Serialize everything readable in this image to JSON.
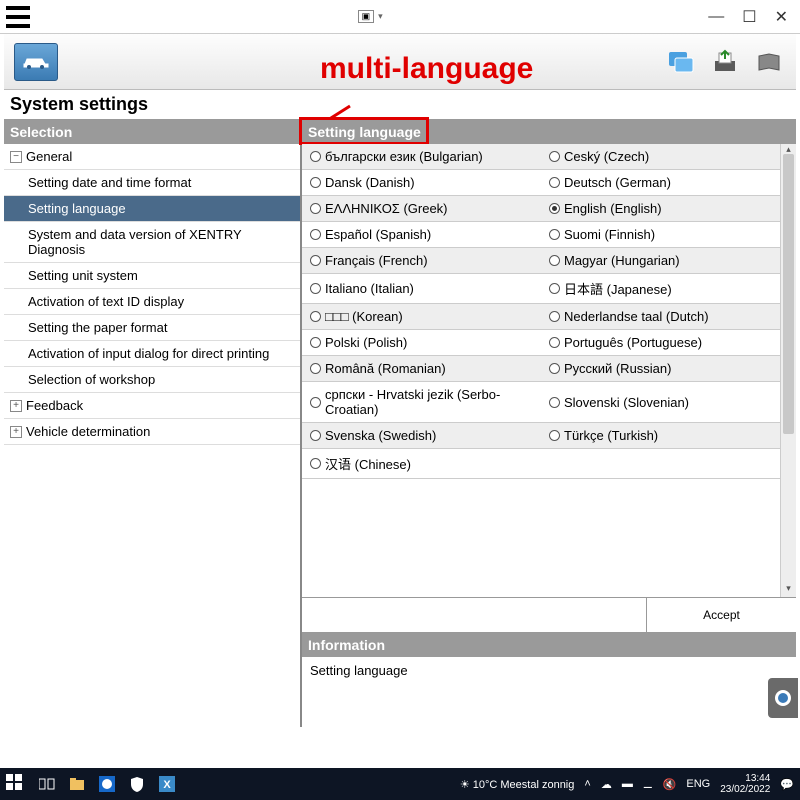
{
  "annotation": "multi-language",
  "window": {
    "min": "—",
    "max": "☐",
    "close": "✕"
  },
  "page_title": "System settings",
  "sidebar": {
    "header": "Selection",
    "groups": [
      {
        "label": "General",
        "expanded": true
      },
      {
        "label": "Feedback",
        "expanded": false
      },
      {
        "label": "Vehicle determination",
        "expanded": false
      }
    ],
    "general_items": [
      "Setting date and time format",
      "Setting language",
      "System and data version of XENTRY Diagnosis",
      "Setting unit system",
      "Activation of text ID display",
      "Setting the paper format",
      "Activation of input dialog for direct printing",
      "Selection of workshop"
    ],
    "active_index": 1
  },
  "main": {
    "header": "Setting language",
    "languages": [
      {
        "left": "български език (Bulgarian)",
        "right": "Ceský (Czech)"
      },
      {
        "left": "Dansk (Danish)",
        "right": "Deutsch (German)"
      },
      {
        "left": "ΕΛΛΗΝΙΚΟΣ (Greek)",
        "right": "English (English)",
        "right_checked": true
      },
      {
        "left": "Español (Spanish)",
        "right": "Suomi (Finnish)"
      },
      {
        "left": "Français (French)",
        "right": "Magyar (Hungarian)"
      },
      {
        "left": "Italiano (Italian)",
        "right": "日本語 (Japanese)"
      },
      {
        "left": "□□□ (Korean)",
        "right": "Nederlandse taal (Dutch)"
      },
      {
        "left": "Polski (Polish)",
        "right": "Português (Portuguese)"
      },
      {
        "left": "Română (Romanian)",
        "right": "Русский (Russian)"
      },
      {
        "left": "српски - Hrvatski jezik (Serbo-Croatian)",
        "right": "Slovenski (Slovenian)"
      },
      {
        "left": "Svenska (Swedish)",
        "right": "Türkçe (Turkish)"
      },
      {
        "left": "汉语 (Chinese)",
        "right": ""
      }
    ],
    "accept": "Accept",
    "info_header": "Information",
    "info_body": "Setting language"
  },
  "taskbar": {
    "weather": "10°C  Meestal zonnig",
    "lang": "ENG",
    "time": "13:44",
    "date": "23/02/2022"
  }
}
